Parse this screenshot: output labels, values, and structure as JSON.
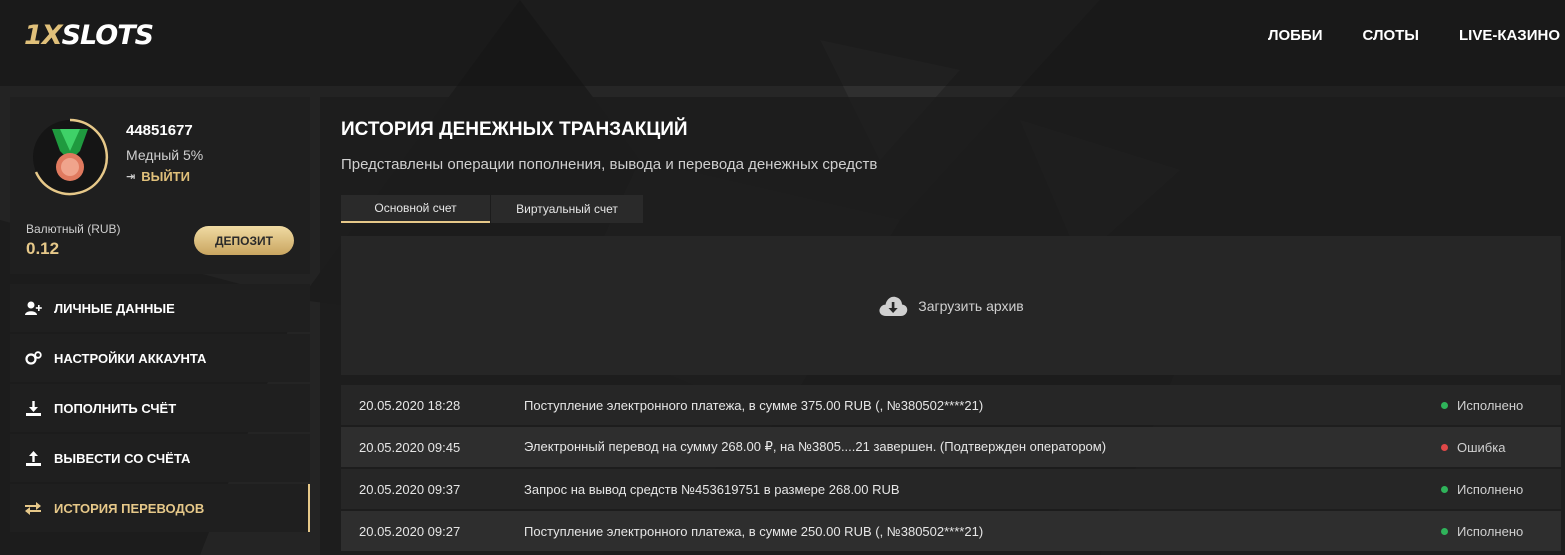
{
  "header": {
    "logo_prefix": "1X",
    "logo_suffix": "SLOTS",
    "nav": [
      {
        "label": "ЛОББИ"
      },
      {
        "label": "СЛОТЫ"
      },
      {
        "label": "LIVE-КАЗИНО"
      }
    ]
  },
  "profile": {
    "user_id": "44851677",
    "level": "Медный 5%",
    "logout_label": "ВЫЙТИ",
    "balance_label": "Валютный (RUB)",
    "balance_value": "0.12",
    "deposit_label": "ДЕПОЗИТ"
  },
  "menu": [
    {
      "label": "ЛИЧНЫЕ ДАННЫЕ",
      "icon": "user-plus-icon",
      "active": false
    },
    {
      "label": "НАСТРОЙКИ АККАУНТА",
      "icon": "gears-icon",
      "active": false
    },
    {
      "label": "ПОПОЛНИТЬ СЧЁТ",
      "icon": "download-icon",
      "active": false
    },
    {
      "label": "ВЫВЕСТИ СО СЧЁТА",
      "icon": "upload-icon",
      "active": false
    },
    {
      "label": "ИСТОРИЯ ПЕРЕВОДОВ",
      "icon": "transfer-arrows-icon",
      "active": true
    }
  ],
  "main": {
    "title": "ИСТОРИЯ ДЕНЕЖНЫХ ТРАНЗАКЦИЙ",
    "subtitle": "Представлены операции пополнения, вывода и перевода денежных средств",
    "tabs": [
      {
        "label": "Основной счет",
        "active": true
      },
      {
        "label": "Виртуальный счет",
        "active": false
      }
    ],
    "archive_label": "Загрузить архив",
    "transactions": [
      {
        "date": "20.05.2020 18:28",
        "description": "Поступление электронного платежа, в сумме 375.00 RUB (, №380502****21)",
        "status": "Исполнено",
        "status_color": "#2fb35a"
      },
      {
        "date": "20.05.2020 09:45",
        "description": "Электронный перевод на сумму 268.00 ₽, на №3805....21 завершен. (Подтвержден оператором)",
        "status": "Ошибка",
        "status_color": "#e04848"
      },
      {
        "date": "20.05.2020 09:37",
        "description": "Запрос на вывод средств №453619751 в размере 268.00 RUB",
        "status": "Исполнено",
        "status_color": "#2fb35a"
      },
      {
        "date": "20.05.2020 09:27",
        "description": "Поступление электронного платежа, в сумме 250.00 RUB (, №380502****21)",
        "status": "Исполнено",
        "status_color": "#2fb35a"
      }
    ]
  },
  "colors": {
    "accent": "#e6c889",
    "success": "#2fb35a",
    "error": "#e04848"
  }
}
